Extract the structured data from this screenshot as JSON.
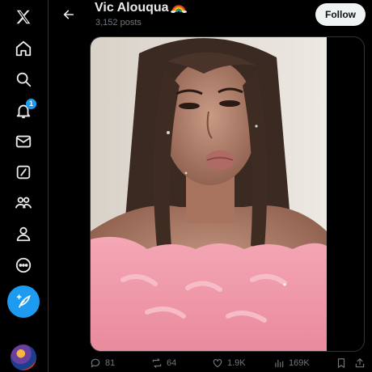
{
  "header": {
    "name": "Vic Alouqua",
    "posts_count": "3,152 posts",
    "follow_label": "Follow"
  },
  "nav": {
    "items": [
      {
        "name": "x-logo-icon"
      },
      {
        "name": "home-icon"
      },
      {
        "name": "search-icon"
      },
      {
        "name": "bell-icon",
        "badge": "1"
      },
      {
        "name": "mail-icon"
      },
      {
        "name": "grok-icon"
      },
      {
        "name": "communities-icon"
      },
      {
        "name": "profile-icon"
      },
      {
        "name": "more-icon"
      }
    ],
    "post_button_icon": "feather-plus-icon"
  },
  "actions": {
    "replies": "81",
    "reposts": "64",
    "likes": "1.9K",
    "views": "169K"
  },
  "colors": {
    "accent": "#1d9bf0",
    "background": "#000000",
    "text": "#e7e9ea",
    "muted": "#71767b"
  }
}
